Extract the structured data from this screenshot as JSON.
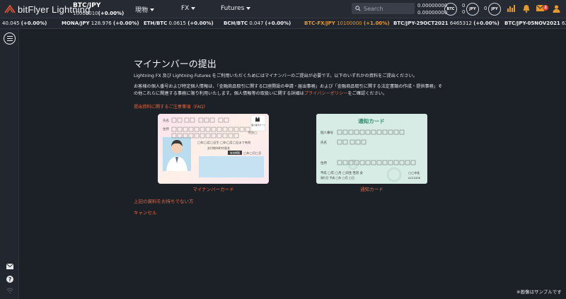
{
  "header": {
    "logo_text": "bitFlyer Lightning",
    "pair": {
      "name": "BTC/JPY",
      "price": "10000010",
      "change": "(+0.00%)"
    },
    "nav": [
      {
        "label": "現物"
      },
      {
        "label": "FX"
      },
      {
        "label": "Futures"
      }
    ],
    "search": {
      "placeholder": "Search"
    },
    "balances": {
      "line1": "0.00000000",
      "line2": "0.00000000"
    },
    "coins": {
      "btc": "BTC",
      "jpy": "JPY",
      "jpy2": "JPY"
    },
    "zeros": {
      "a": "0",
      "b": "0",
      "c": "0",
      "d": "0"
    },
    "mail_badge": "2"
  },
  "ticker": [
    {
      "symbol": "",
      "price": "40.045",
      "change": "(+0.00%)",
      "active": false
    },
    {
      "symbol": "MONA/JPY",
      "price": "128.976",
      "change": "(+0.00%)",
      "active": false
    },
    {
      "symbol": "ETH/BTC",
      "price": "0.0615",
      "change": "(+0.00%)",
      "active": false
    },
    {
      "symbol": "BCH/BTC",
      "price": "0.047",
      "change": "(+0.00%)",
      "active": false
    },
    {
      "symbol": "BTC-FX/JPY",
      "price": "10100000",
      "change": "(+1.00%)",
      "active": true
    },
    {
      "symbol": "BTC/JPY-29OCT2021",
      "price": "6465312",
      "change": "(+0.00%)",
      "active": false
    },
    {
      "symbol": "BTC/JPY-05NOV2021",
      "price": "621",
      "change": "",
      "active": false
    }
  ],
  "main": {
    "title": "マイナンバーの提出",
    "para1": "Lightning FX 及び Lightning Futures をご利用いただくためにはマイナンバーのご提出が必要です。以下のいずれかの資料をご提出ください。",
    "para2_a": "お客様の個人番号および特定個人情報は、「金融商品取引に関する口座開設の申請・届出事務」および「金融商品取引に関する法定書類の作成・提供事務」その他これらに関連する事務に限り利用いたします。個人情報等の取扱いに関する詳細は",
    "para2_link": "プライバシーポリシー",
    "para2_b": "をご確認ください。",
    "faq_link": "提出資料に関するご注意事項（FAQ）",
    "cards": [
      {
        "caption": "マイナンバーカード"
      },
      {
        "caption": "通知カード"
      }
    ],
    "no_docs_link": "上記の資料をお持ちでない方",
    "cancel_link": "キャンセル",
    "sample_note": "※画像はサンプルです"
  },
  "mynumber_card": {
    "label_name": "氏名",
    "label_address": "住所",
    "birth": "◯年◯月◯日生",
    "expiry": "◯年◯月◯日まで有効",
    "issuer": "交付地市町村長名",
    "valid_label": "有効期限",
    "badge": "個人番号カード",
    "sex_label": "性別◯",
    "bottom_label": "◯年◯月◯日"
  },
  "notice_card": {
    "title": "通知カード",
    "label_number": "個人番号",
    "label_name": "氏名",
    "label_address": "住所",
    "line1": "平成 ◯年 ◯月 ◯日生 性別 女",
    "line2": "発行日 平成 ◯年 ◯月 ◯日",
    "right1": "◯◯市長",
    "right2": "A123456"
  },
  "colors": {
    "link": "#e26a44",
    "ticker_active": "#e59a2e",
    "background": "#1c2027",
    "header": "#262a33"
  }
}
